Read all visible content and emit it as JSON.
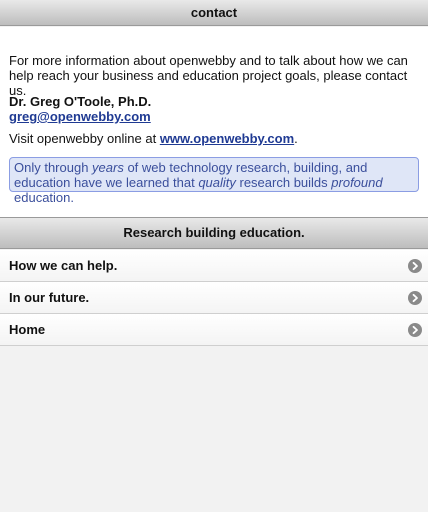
{
  "header": {
    "title": "contact"
  },
  "content": {
    "intro": "For more information about openwebby and to talk about how we can help reach your business and education project goals, please contact us.",
    "name": "Dr. Greg O'Toole, Ph.D.",
    "email": "greg@openwebby.com",
    "visit_prefix": "Visit openwebby online at ",
    "visit_link": "www.openwebby.com",
    "visit_suffix": ".",
    "quote": {
      "t1": "Only through ",
      "i1": "years",
      "t2": " of web technology research, building, and education have we learned that ",
      "i2": "quality",
      "t3": " research builds ",
      "i3": "profound",
      "t4": " education."
    }
  },
  "section": {
    "title": "Research building education."
  },
  "menu": {
    "items": [
      {
        "label": "How we can help."
      },
      {
        "label": "In our future."
      },
      {
        "label": "Home"
      }
    ]
  },
  "colors": {
    "link": "#1f3a93",
    "quote_bg": "#dfe6f7",
    "quote_border": "#8b9de3",
    "quote_text": "#3b4f9c"
  },
  "icons": {
    "menu_arrow": "chevron-right-circle-icon"
  }
}
